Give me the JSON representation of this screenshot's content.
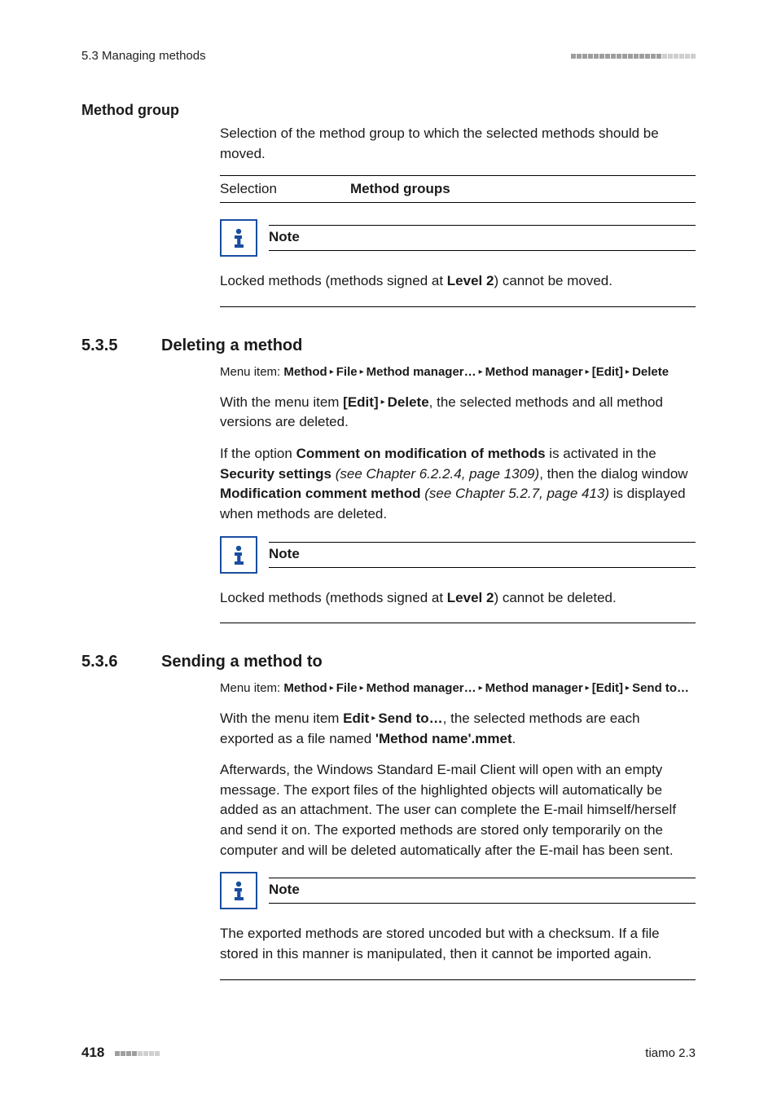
{
  "header": {
    "left": "5.3 Managing methods"
  },
  "method_group": {
    "title": "Method group",
    "desc": "Selection of the method group to which the selected methods should be moved.",
    "sel_label": "Selection",
    "sel_value": "Method groups",
    "note_title": "Note",
    "note_body_a": "Locked methods (methods signed at ",
    "note_body_b": "Level 2",
    "note_body_c": ") cannot be moved."
  },
  "s535": {
    "num": "5.3.5",
    "title": "Deleting a method",
    "menu_prefix": "Menu item: ",
    "m1": "Method",
    "m2": "File",
    "m3": "Method manager…",
    "m4": "Method manager",
    "m5": "[Edit]",
    "m6": "Delete",
    "p1a": "With the menu item ",
    "p1b": "[Edit]",
    "p1tri": " ▸ ",
    "p1c": "Delete",
    "p1d": ", the selected methods and all method versions are deleted.",
    "p2a": "If the option ",
    "p2b": "Comment on modification of methods",
    "p2c": " is activated in the ",
    "p2d": "Security settings",
    "p2e": " (see Chapter 6.2.2.4, page 1309)",
    "p2f": ", then the dialog window ",
    "p2g": "Modification comment method",
    "p2h": " (see Chapter 5.2.7, page 413)",
    "p2i": " is displayed when methods are deleted.",
    "note_title": "Note",
    "note_a": "Locked methods (methods signed at ",
    "note_b": "Level 2",
    "note_c": ") cannot be deleted."
  },
  "s536": {
    "num": "5.3.6",
    "title": "Sending a method to",
    "menu_prefix": "Menu item: ",
    "m1": "Method",
    "m2": "File",
    "m3": "Method manager…",
    "m4": "Method manager",
    "m5": "[Edit]",
    "m6": "Send to…",
    "p1a": "With the menu item ",
    "p1b": "Edit",
    "p1tri": " ▸ ",
    "p1c": "Send to…",
    "p1d": ", the selected methods are each exported as a file named ",
    "p1e": "'Method name'.mmet",
    "p1f": ".",
    "p2": "Afterwards, the Windows Standard E-mail Client will open with an empty message. The export files of the highlighted objects will automatically be added as an attachment. The user can complete the E-mail himself/herself and send it on. The exported methods are stored only temporarily on the computer and will be deleted automatically after the E-mail has been sent.",
    "note_title": "Note",
    "note_body": "The exported methods are stored uncoded but with a checksum. If a file stored in this manner is manipulated, then it cannot be imported again."
  },
  "footer": {
    "page": "418",
    "product": "tiamo 2.3"
  }
}
